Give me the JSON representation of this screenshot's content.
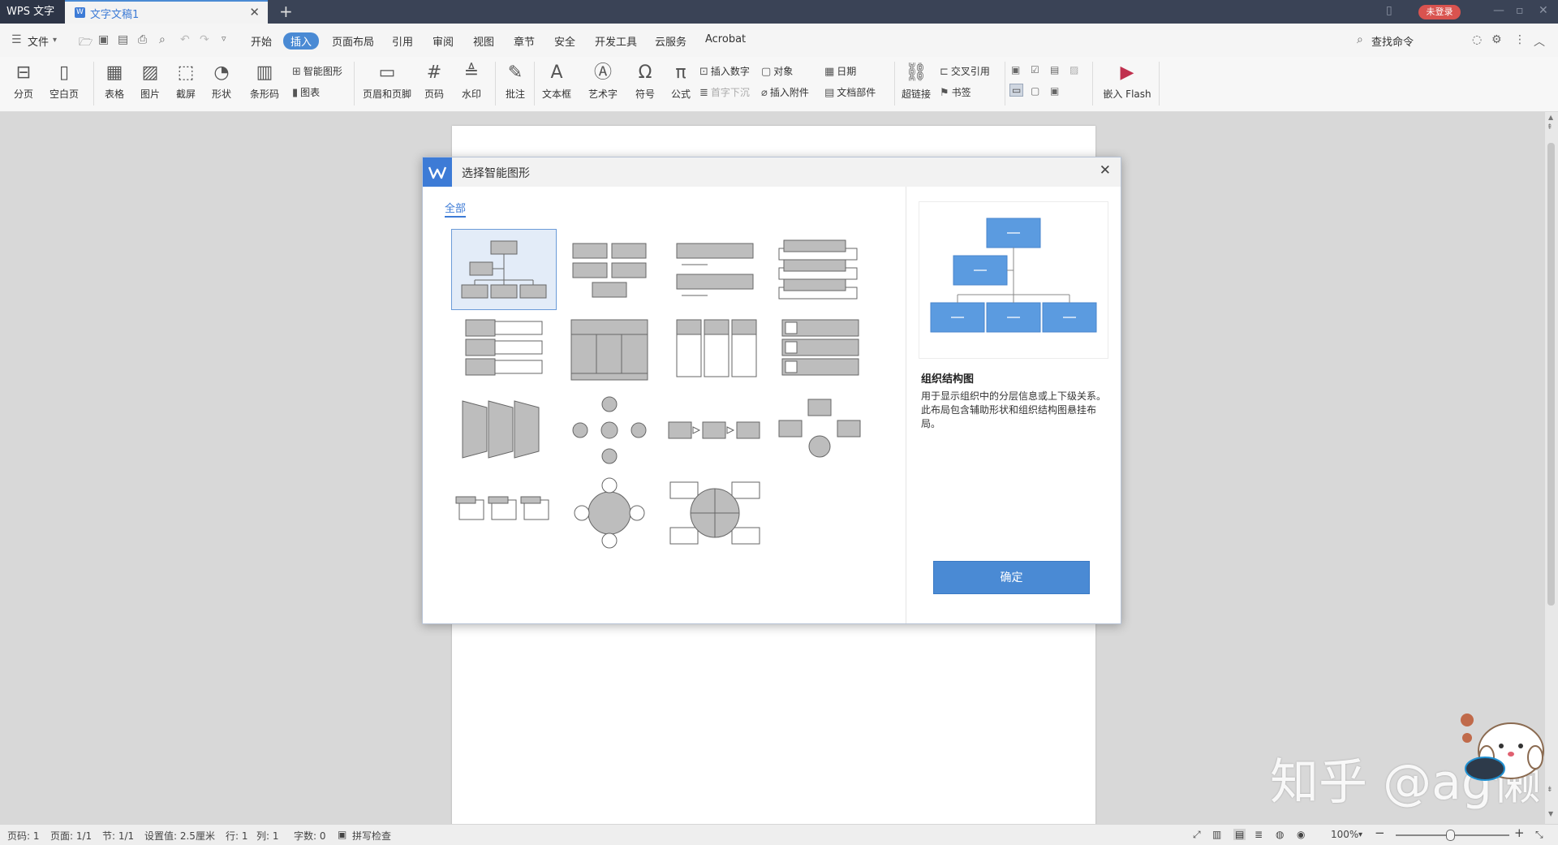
{
  "titlebar": {
    "app_name": "WPS 文字",
    "doc_tab": "文字文稿1",
    "login_badge": "未登录"
  },
  "menubar": {
    "file": "文件",
    "tabs": [
      "开始",
      "插入",
      "页面布局",
      "引用",
      "审阅",
      "视图",
      "章节",
      "安全",
      "开发工具",
      "云服务",
      "Acrobat"
    ],
    "active_tab": "插入",
    "search": "查找命令"
  },
  "ribbon": {
    "big": {
      "page_break": "分页",
      "blank_page": "空白页",
      "table": "表格",
      "picture": "图片",
      "screenshot": "截屏",
      "shape": "形状",
      "barcode": "条形码",
      "header_footer": "页眉和页脚",
      "page_number": "页码",
      "watermark": "水印",
      "comment": "批注",
      "textbox": "文本框",
      "art_text": "艺术字",
      "symbol": "符号",
      "formula": "公式",
      "hyperlink": "超链接",
      "embed_flash": "嵌入 Flash"
    },
    "small": {
      "smart_shape": "智能图形",
      "chart": "图表",
      "insert_number": "插入数字",
      "drop_cap": "首字下沉",
      "object": "对象",
      "attachment": "插入附件",
      "date": "日期",
      "doc_parts": "文档部件",
      "cross_ref": "交叉引用",
      "bookmark": "书签"
    }
  },
  "dialog": {
    "title": "选择智能图形",
    "category": "全部",
    "preview_title": "组织结构图",
    "preview_desc": "用于显示组织中的分层信息或上下级关系。此布局包含辅助形状和组织结构图悬挂布局。",
    "ok": "确定"
  },
  "statusbar": {
    "page_code": "页码: 1",
    "page": "页面: 1/1",
    "section": "节: 1/1",
    "setting": "设置值: 2.5厘米",
    "row": "行: 1",
    "col": "列: 1",
    "word_count": "字数: 0",
    "spell_check": "拼写检查",
    "zoom": "100%"
  },
  "watermark": {
    "text": "知乎 @ag懒"
  },
  "colors": {
    "accent": "#4a8ad4",
    "titlebar": "#3a4356",
    "shape_fill": "#bdbdbd",
    "preview_fill": "#5b9be0"
  }
}
